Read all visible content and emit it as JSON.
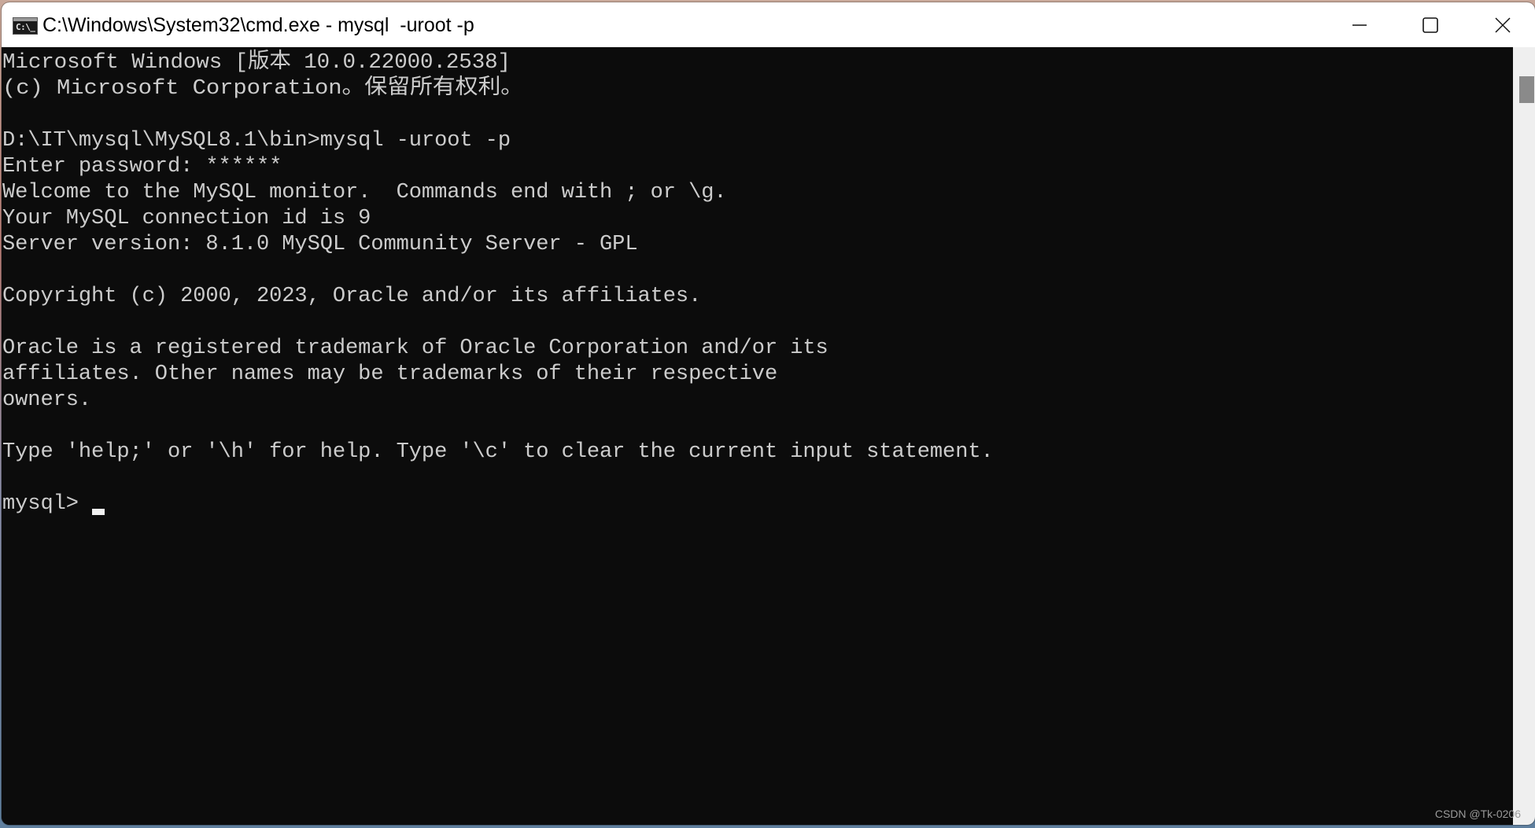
{
  "window": {
    "title": "C:\\Windows\\System32\\cmd.exe - mysql  -uroot -p",
    "icon": "cmd-icon",
    "icon_text": "C:\\_",
    "controls": {
      "minimize_icon": "minimize-icon",
      "maximize_icon": "maximize-icon",
      "close_icon": "close-icon"
    }
  },
  "terminal": {
    "foreground": "#cccccc",
    "background": "#0c0c0c",
    "lines": [
      "Microsoft Windows [版本 10.0.22000.2538]",
      "(c) Microsoft Corporation。保留所有权利。",
      "",
      "D:\\IT\\mysql\\MySQL8.1\\bin>mysql -uroot -p",
      "Enter password: ******",
      "Welcome to the MySQL monitor.  Commands end with ; or \\g.",
      "Your MySQL connection id is 9",
      "Server version: 8.1.0 MySQL Community Server - GPL",
      "",
      "Copyright (c) 2000, 2023, Oracle and/or its affiliates.",
      "",
      "Oracle is a registered trademark of Oracle Corporation and/or its",
      "affiliates. Other names may be trademarks of their respective",
      "owners.",
      "",
      "Type 'help;' or '\\h' for help. Type '\\c' to clear the current input statement.",
      "",
      "mysql> "
    ]
  },
  "watermark": "CSDN @Tk-0206"
}
